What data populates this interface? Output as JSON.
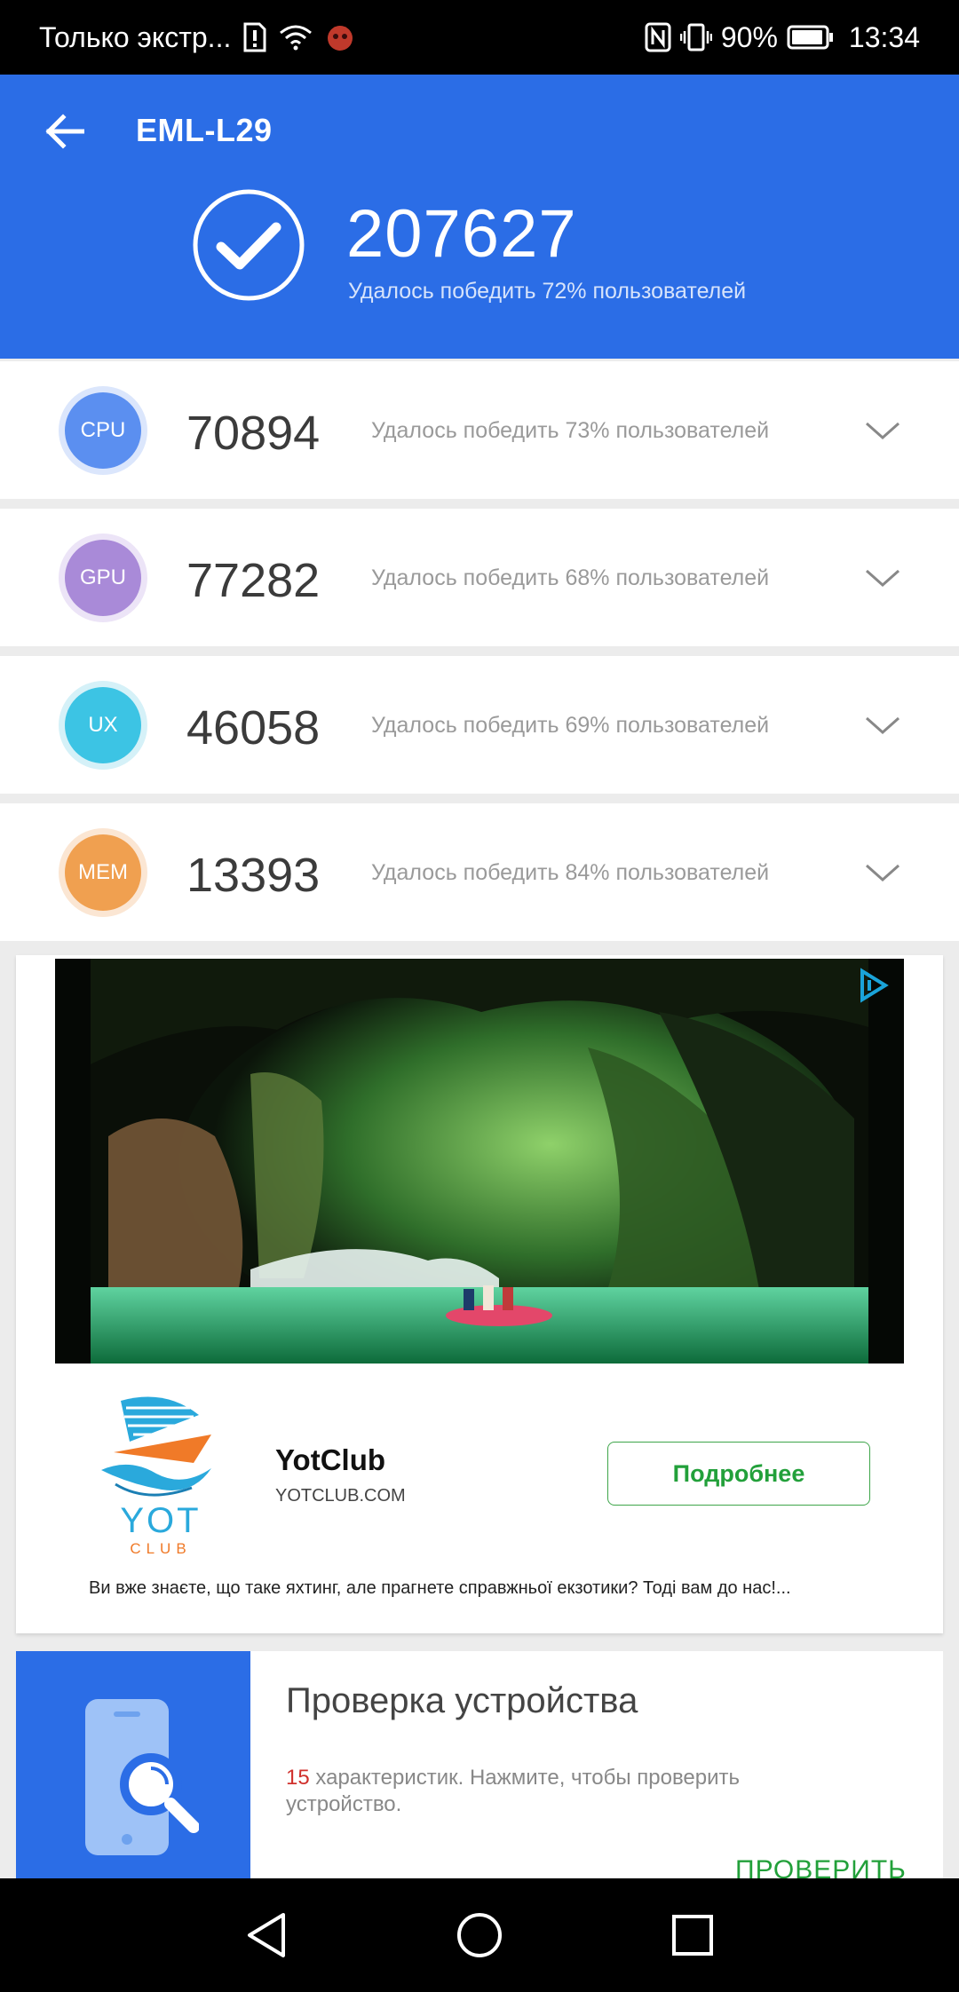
{
  "status_bar": {
    "carrier": "Только экстр...",
    "battery": "90%",
    "time": "13:34"
  },
  "header": {
    "title": "EML-L29",
    "total_score": "207627",
    "total_subtitle": "Удалось победить 72% пользователей",
    "color": "#2b6de6"
  },
  "scores": [
    {
      "label": "CPU",
      "score": "70894",
      "subtitle": "Удалось победить 73% пользователей",
      "color": "#5b8ff0"
    },
    {
      "label": "GPU",
      "score": "77282",
      "subtitle": "Удалось победить 68% пользователей",
      "color": "#a98ad8"
    },
    {
      "label": "UX",
      "score": "46058",
      "subtitle": "Удалось победить 69% пользователей",
      "color": "#3cc4e4"
    },
    {
      "label": "MEM",
      "score": "13393",
      "subtitle": "Удалось победить 84% пользователей",
      "color": "#f0a050"
    }
  ],
  "ad": {
    "logo_text": "YOT",
    "logo_subtext": "CLUB",
    "name": "YotClub",
    "domain": "YOTCLUB.COM",
    "button_label": "Подробнее",
    "description": "Ви вже знаєте, що таке яхтинг, але прагнете справжньої екзотики? Тоді вам до нас!..."
  },
  "device_check": {
    "title": "Проверка устройства",
    "count": "15",
    "description": "характеристик. Нажмите, чтобы проверить устройство.",
    "action_label": "ПРОВЕРИТЬ"
  },
  "navigation": [
    "back-icon",
    "home-icon",
    "recents-icon"
  ],
  "colors": {
    "accent_green": "#22a03a",
    "highlight_red": "#d0312d"
  }
}
